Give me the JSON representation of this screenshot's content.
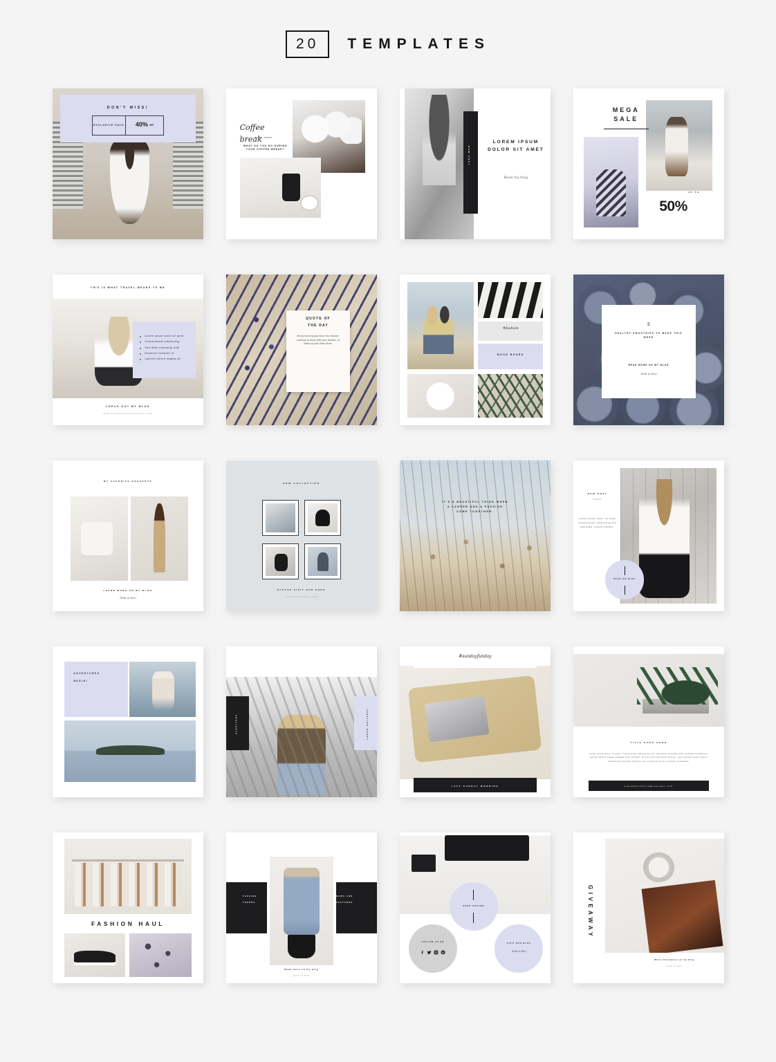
{
  "header": {
    "count": "20",
    "title": "TEMPLATES"
  },
  "colors": {
    "lavender": "#dcdcf0",
    "black": "#1d1d1f",
    "background": "#f4f4f4",
    "gray": "#d4d4d4"
  },
  "templates": [
    {
      "id": "dont-miss-sale",
      "headline": "DON'T MISS!",
      "badge_left": "Exclusive sale",
      "badge_right": "40%",
      "badge_right_small": "OFF"
    },
    {
      "id": "coffee-break",
      "script_title": "Coffee break",
      "subtitle": "BLOG POST",
      "body": "WHAT DO YOU DO DURING YOUR COFFEE BREAK?"
    },
    {
      "id": "lorem-new-post",
      "vertical_label": "NEW POST",
      "headline": "LOREM IPSUM DOLOR SIT AMET",
      "signature": "Read my blog"
    },
    {
      "id": "mega-sale",
      "headline_1": "MEGA",
      "headline_2": "SALE",
      "up_to": "UP TO",
      "percent": "50%"
    },
    {
      "id": "travel-means",
      "headline": "THIS IS WHAT TRAVEL MEANS TO ME",
      "bullets": [
        "Lorem ipsum dolor sit amet",
        "Consectetuer adipiscing",
        "Sed diam nonummy nibh",
        "Euismod tincidunt ut",
        "Laoreet dolore magna ali"
      ],
      "cta": "CHECK OUT MY BLOG",
      "url": "www.blogaboutyourwebsite.com"
    },
    {
      "id": "quote-of-the-day",
      "quote_title_1": "QUOTE OF",
      "quote_title_2": "THE DAY",
      "quote_body": "Every morning you have two choices: continue to sleep with your dreams, or wake up and chase them."
    },
    {
      "id": "mood-board",
      "script_tag": "#fashion",
      "mood_label": "MOOD BOARD"
    },
    {
      "id": "healthy-smoothies",
      "number": "5",
      "headline": "HEALTHY SMOOTHIES TO MAKE THIS WEEK",
      "cta": "Read more on my blog",
      "link": "(link in bio)"
    },
    {
      "id": "favorite-desserts",
      "headline": "MY FAVORITE DESSERTS",
      "cta": "LEARN MORE ON MY BLOG",
      "link": "(link in bio)"
    },
    {
      "id": "new-collection",
      "headline": "NEW COLLECTION",
      "cta": "PLEASE VISIT OUR SHOP",
      "url": "yourwebsitehere.com"
    },
    {
      "id": "career-passion-quote",
      "quote": "IT'S A BEAUTIFUL THING WHEN A CAREER AND A PASSION COME TOGETHER."
    },
    {
      "id": "new-post-circle",
      "headline": "NEW POST",
      "subtitle": "TODAY",
      "body": "Lorem ipsum dolor sit amet consectetuer adipiscing elit sed diam nonum nibhdui.",
      "circle_cta": "READ ON BLOG"
    },
    {
      "id": "adventures-begin",
      "headline_1": "ADVENTURES",
      "headline_2": "BEGIN!"
    },
    {
      "id": "holidays-feeling-happy",
      "tag_black": "#HOLIDAYS",
      "tag_lavender": "#FEELING HAPPY"
    },
    {
      "id": "sunday-funday",
      "script_tag": "#sundayfunday",
      "banner": "LAZY SUNDAY MORNING"
    },
    {
      "id": "title-goes-here",
      "headline": "TITLE GOES HERE",
      "body": "Lorem ipsum dolor sit amet, consectetuer adipiscing elit, sed diam nonummy nibh euismod tincidunt ut laoreet dolore magna aliquam erat volutpat. Ut wisi enim ad minim veniam, quis nostrud exerci tation ullamcorper suscipit lobortis nisl ut aliquip ex ea commodo consequat.",
      "banner_url": "yourwebsitehere@yourmail.com"
    },
    {
      "id": "fashion-haul",
      "headline": "FASHION HAUL"
    },
    {
      "id": "fashion-trends",
      "tag_left_1": "FASHION",
      "tag_left_2": "TRENDS",
      "tag_right_1": "NEWS AND",
      "tag_right_2": "FEATURES",
      "cta": "Read more on my blog",
      "link": "(link in bio)"
    },
    {
      "id": "shop-online-circles",
      "circle_top": "SHOP ONLINE",
      "circle_left": "FOLLOW US ON",
      "circle_right": "VISIT OUR BLOG",
      "circle_right_link": "(link in bio)",
      "social_icons": [
        "facebook-icon",
        "twitter-icon",
        "instagram-icon",
        "pinterest-icon"
      ]
    },
    {
      "id": "giveaway",
      "vertical_headline": "GIVEAWAY",
      "cta": "More information on my blog",
      "link": "(link in bio)"
    }
  ]
}
